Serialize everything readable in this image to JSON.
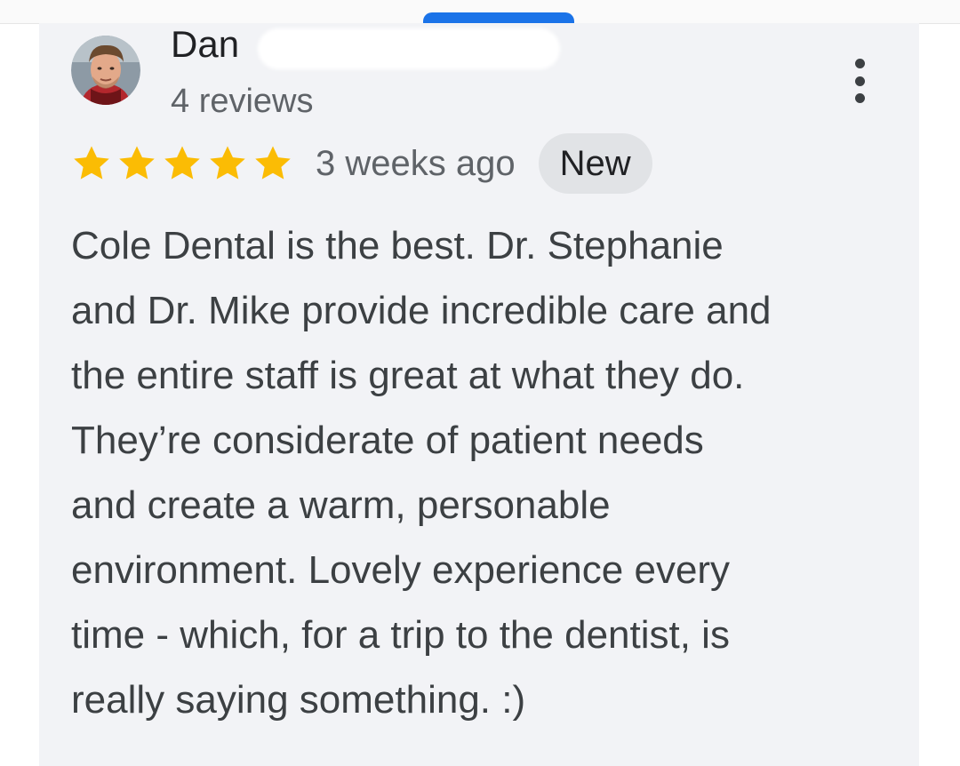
{
  "review": {
    "author_name": "Dan",
    "author_reviews": "4 reviews",
    "rating": 5,
    "rating_max": 5,
    "time_ago": "3 weeks ago",
    "badge": "New",
    "text_lines": [
      "Cole Dental is the best. Dr. Stephanie",
      "and Dr. Mike provide incredible care and",
      "the entire staff is great at what they do.",
      "They’re considerate of patient needs",
      "and create a warm, personable",
      "environment. Lovely experience every",
      "time - which, for a trip to the dentist, is",
      "really saying something. :)"
    ]
  },
  "icons": {
    "star": "star-icon",
    "more": "more-vert-icon"
  },
  "colors": {
    "star": "#fbbc04",
    "card_background": "#f2f3f6",
    "accent_tab": "#1a73e8",
    "badge_background": "#e1e3e6"
  }
}
